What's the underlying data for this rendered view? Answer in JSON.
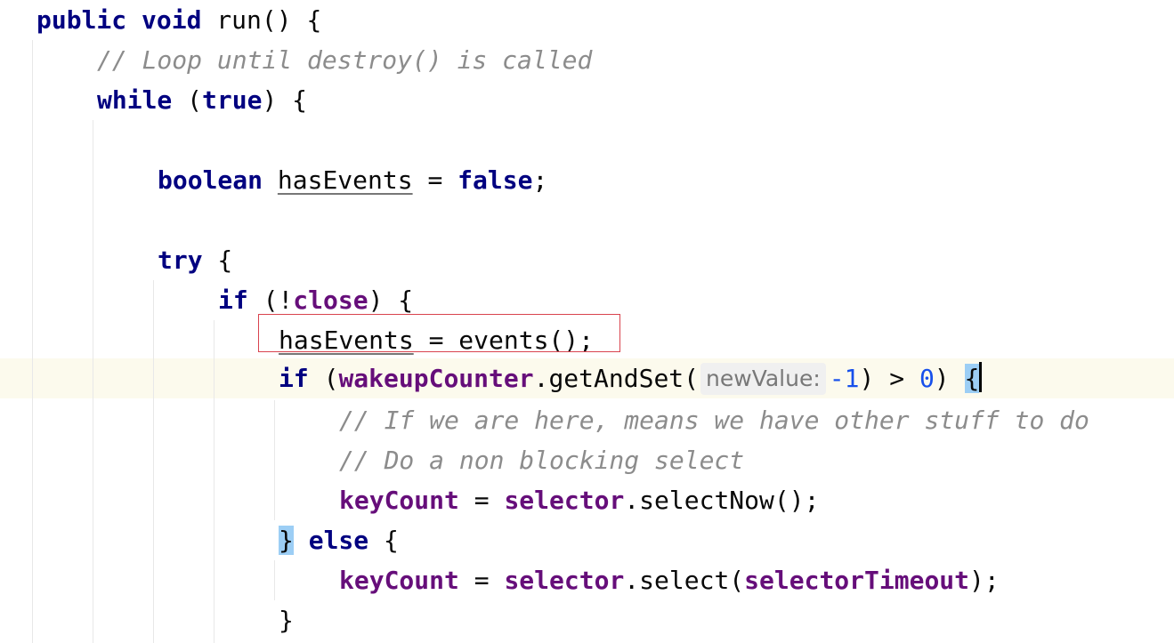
{
  "code": {
    "l1_kw1": "public",
    "l1_kw2": "void",
    "l1_rest": " run() {",
    "l2_comment": "// Loop until destroy() is called",
    "l3_kw": "while",
    "l3_open": " (",
    "l3_true": "true",
    "l3_close": ") {",
    "l5_kw": "boolean",
    "l5_var": "hasEvents",
    "l5_eq": " = ",
    "l5_false": "false",
    "l5_semi": ";",
    "l7_kw": "try",
    "l7_rest": " {",
    "l8_kw": "if",
    "l8_open": " (!",
    "l8_field": "close",
    "l8_close": ") {",
    "l9_var": "hasEvents",
    "l9_rest": " = events();",
    "l10_kw": "if",
    "l10_open": " (",
    "l10_field": "wakeupCounter",
    "l10_call": ".getAndSet(",
    "l10_hint": "newValue:",
    "l10_num1": "-1",
    "l10_mid": ") > ",
    "l10_num2": "0",
    "l10_close": ") ",
    "l10_brace": "{",
    "l11_comment": "// If we are here, means we have other stuff to do",
    "l12_comment": "// Do a non blocking select",
    "l13_field1": "keyCount",
    "l13_eq": " = ",
    "l13_field2": "selector",
    "l13_call": ".selectNow();",
    "l14_brace": "}",
    "l14_kw": "else",
    "l14_rest": " {",
    "l15_field1": "keyCount",
    "l15_eq": " = ",
    "l15_field2": "selector",
    "l15_call": ".select(",
    "l15_field3": "selectorTimeout",
    "l15_end": ");",
    "l16_brace": "}"
  },
  "colors": {
    "keyword": "#000080",
    "comment": "#8c8c8c",
    "field": "#660e7a",
    "number": "#1750eb",
    "current_line": "#fcfaed",
    "highlight_box": "#d9434e",
    "brace_match": "#9ccef5"
  }
}
